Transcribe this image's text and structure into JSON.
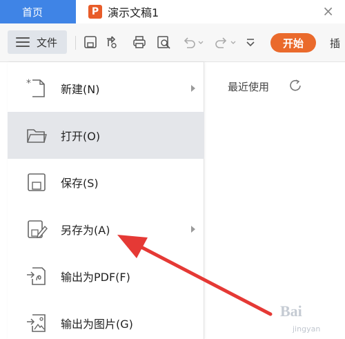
{
  "tabs": {
    "home_label": "首页",
    "doc_icon_letter": "P",
    "doc_title": "演示文稿1",
    "close_glyph": "×"
  },
  "toolbar": {
    "file_label": "文件",
    "start_label": "开始",
    "insert_label": "插",
    "icons": [
      "save-icon",
      "save-as-cloud-icon",
      "print-icon",
      "print-preview-icon",
      "undo-icon",
      "redo-icon",
      "more-dropdown-icon"
    ]
  },
  "file_menu": {
    "items": [
      {
        "label": "新建(N)",
        "icon": "new-file-icon",
        "has_submenu": true,
        "active": false
      },
      {
        "label": "打开(O)",
        "icon": "open-folder-icon",
        "has_submenu": false,
        "active": true
      },
      {
        "label": "保存(S)",
        "icon": "save-icon",
        "has_submenu": false,
        "active": false
      },
      {
        "label": "另存为(A)",
        "icon": "save-as-icon",
        "has_submenu": true,
        "active": false
      },
      {
        "label": "输出为PDF(F)",
        "icon": "export-pdf-icon",
        "has_submenu": false,
        "active": false
      },
      {
        "label": "输出为图片(G)",
        "icon": "export-image-icon",
        "has_submenu": false,
        "active": false
      }
    ]
  },
  "recent": {
    "title": "最近使用"
  },
  "watermark": {
    "brand": "Bai",
    "sub": "jingyan"
  },
  "colors": {
    "accent_blue": "#3f84e6",
    "start_orange": "#ea6a2c",
    "arrow_red": "#e53935",
    "active_bg": "#e4e6ea"
  }
}
